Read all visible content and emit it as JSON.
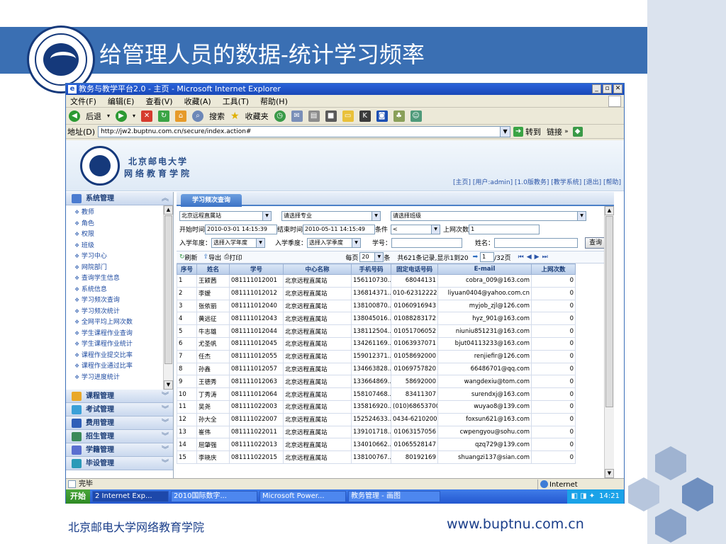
{
  "slide": {
    "title": "给管理人员的数据-统计学习频率",
    "footer_left": "北京邮电大学网络教育学院",
    "footer_right": "www.buptnu.com.cn"
  },
  "window": {
    "title": "教务与教学平台2.0 - 主页 - Microsoft Internet Explorer",
    "menu": [
      "文件(F)",
      "编辑(E)",
      "查看(V)",
      "收藏(A)",
      "工具(T)",
      "帮助(H)"
    ],
    "toolbar": {
      "back": "后退",
      "search": "搜索",
      "favorites": "收藏夹"
    },
    "address_label": "地址(D)",
    "address_url": "http://jw2.buptnu.com.cn/secure/index.action#",
    "go_label": "转到",
    "links_label": "链接"
  },
  "page": {
    "header": {
      "name_line1": "北京邮电大学",
      "name_line2": "网络教育学院",
      "top_links": "[主页] [用户:admin] [1.0版教务] [教学系统] [退出] [帮助]"
    },
    "sidebar": {
      "system_header": "系统管理",
      "items": [
        "教师",
        "角色",
        "权限",
        "班级",
        "学习中心",
        "网院部门",
        "查询学生信息",
        "系统信息",
        "学习频次查询",
        "学习频次统计",
        "全网平均上网次数",
        "学生课程作业查询",
        "学生课程作业统计",
        "课程作业提交比率",
        "课程作业通过比率",
        "学习进度统计"
      ],
      "sections": [
        "课程管理",
        "考试管理",
        "费用管理",
        "招生管理",
        "学籍管理",
        "毕设管理"
      ]
    },
    "main": {
      "tab": "学习频次查询",
      "filters": {
        "center": "北京远程直属站",
        "major": "请选择专业",
        "class": "请选择班级",
        "start_label": "开始时间",
        "start_value": "2010-03-01 14:15:39",
        "end_label": "结束时间",
        "end_value": "2010-05-11 14:15:49",
        "cond_label": "条件",
        "cond_value": "<",
        "times_label": "上网次数",
        "times_value": "1",
        "year_label": "入学年度：",
        "year_value": "选择入学年度",
        "season_label": "入学季度：",
        "season_value": "选择入学季度",
        "sno_label": "学号：",
        "name_label": "姓名：",
        "query_button": "查询"
      },
      "list_toolbar": {
        "refresh": "刷新",
        "export": "导出",
        "print": "打印",
        "per_page_label": "每页",
        "per_page_value": "20",
        "per_page_unit": "条",
        "summary": "共621条记录,显示1到20",
        "page_value": "1",
        "page_total": "/32页"
      },
      "columns": [
        "序号",
        "姓名",
        "学号",
        "中心名称",
        "手机号码",
        "固定电话号码",
        "E-mail",
        "上网次数"
      ],
      "rows": [
        [
          "1",
          "王颖茜",
          "081111012001",
          "北京远程直属站",
          "156110730...",
          "68044131",
          "cobra_009@163.com",
          "0"
        ],
        [
          "2",
          "李嫒",
          "081111012012",
          "北京远程直属站",
          "136814371...",
          "010-62312222",
          "liyuan0404@yahoo.com.cn",
          "0"
        ],
        [
          "3",
          "张依丽",
          "081111012040",
          "北京远程直属站",
          "138100870...",
          "01060916943",
          "myjob_zjl@126.com",
          "0"
        ],
        [
          "4",
          "黄远征",
          "081111012043",
          "北京远程直属站",
          "138045016...",
          "01088283172",
          "hyz_901@163.com",
          "0"
        ],
        [
          "5",
          "牛志雄",
          "081111012044",
          "北京远程直属站",
          "138112504...",
          "01051706052",
          "niuniu851231@163.com",
          "0"
        ],
        [
          "6",
          "尤圣帆",
          "081111012045",
          "北京远程直属站",
          "134261169...",
          "01063937071",
          "bjut04113233@163.com",
          "0"
        ],
        [
          "7",
          "任杰",
          "081111012055",
          "北京远程直属站",
          "159012371...",
          "01058692000",
          "renjiefir@126.com",
          "0"
        ],
        [
          "8",
          "孙鑫",
          "081111012057",
          "北京远程直属站",
          "134663828...",
          "01069757820",
          "66486701@qq.com",
          "0"
        ],
        [
          "9",
          "王德秀",
          "081111012063",
          "北京远程直属站",
          "133664869...",
          "58692000",
          "wangdexiu@tom.com",
          "0"
        ],
        [
          "10",
          "丁秀涛",
          "081111012064",
          "北京远程直属站",
          "158107468...",
          "83411307",
          "surendxj@163.com",
          "0"
        ],
        [
          "11",
          "吴尧",
          "081111022003",
          "北京远程直属站",
          "135816920...",
          "(010)68653700",
          "wuyao8@139.com",
          "0"
        ],
        [
          "12",
          "孙大全",
          "081111022007",
          "北京远程直属站",
          "152524633...",
          "0434-6210200",
          "foxsun621@163.com",
          "0"
        ],
        [
          "13",
          "崔伟",
          "081111022011",
          "北京远程直属站",
          "139101718...",
          "01063157056",
          "cwpengyou@sohu.com",
          "0"
        ],
        [
          "14",
          "屈肇强",
          "081111022013",
          "北京远程直属站",
          "134010662...",
          "01065528147",
          "qzq729@139.com",
          "0"
        ],
        [
          "15",
          "李晓庆",
          "081111022015",
          "北京远程直属站",
          "138100767...",
          "80192169",
          "shuangzi137@sian.com",
          "0"
        ]
      ]
    }
  },
  "statusbar": {
    "text": "完毕",
    "zone": "Internet"
  },
  "taskbar": {
    "start": "开始",
    "tasks": [
      "2 Internet Exp...",
      "2010国际数字...",
      "Microsoft Power...",
      "教务管理 - 画图"
    ],
    "time": "14:21"
  },
  "colors": {
    "title_band": "#3a6fb3",
    "side_panel": "#dbe3ee",
    "accent": "#1a3e8a"
  }
}
